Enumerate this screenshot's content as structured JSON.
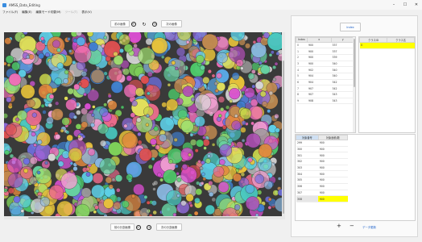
{
  "window": {
    "title": "AMSS_Data_Editing"
  },
  "menu": [
    "ファイル(F)",
    "編集(E)",
    "編集モード切替(M)",
    "ツール(T)",
    "表示(V)"
  ],
  "top_buttons": {
    "prev_image": "前の画像",
    "next_image": "次の画像"
  },
  "bottom_buttons": {
    "prev_mask": "前の分割画像",
    "next_mask": "次の分割画像"
  },
  "right": {
    "top_button": "Index",
    "table1": {
      "headers": [
        "Index",
        "x",
        "y"
      ],
      "rows": [
        [
          "0",
          "900",
          "337"
        ],
        [
          "1",
          "900",
          "337"
        ],
        [
          "2",
          "900",
          "339"
        ],
        [
          "3",
          "900",
          "340"
        ],
        [
          "4",
          "902",
          "340"
        ],
        [
          "5",
          "904",
          "340"
        ],
        [
          "6",
          "904",
          "342"
        ],
        [
          "7",
          "907",
          "342"
        ],
        [
          "8",
          "907",
          "343"
        ],
        [
          "9",
          "908",
          "343"
        ]
      ]
    },
    "table2": {
      "headers": [
        "クラスID",
        "クラス名"
      ],
      "rows": [
        [
          "0",
          ""
        ]
      ]
    },
    "table3": {
      "headers": [
        "対象番号",
        "対象面積/数"
      ],
      "rows": [
        [
          "299",
          "900"
        ],
        [
          "300",
          "900"
        ],
        [
          "301",
          "900"
        ],
        [
          "302",
          "900"
        ],
        [
          "303",
          "900"
        ],
        [
          "304",
          "900"
        ],
        [
          "305",
          "900"
        ],
        [
          "306",
          "900"
        ],
        [
          "307",
          "900"
        ],
        [
          "308",
          "900"
        ]
      ]
    },
    "data_edit_link": "データ更新"
  }
}
